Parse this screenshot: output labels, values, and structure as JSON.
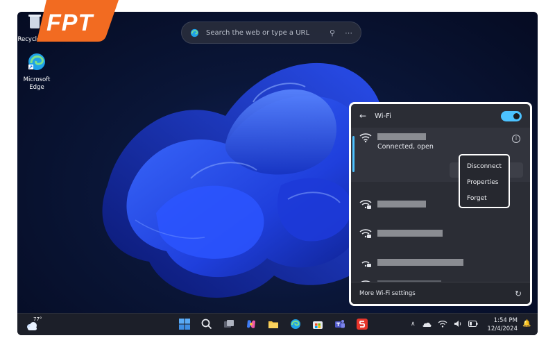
{
  "desktop": {
    "icons": [
      {
        "label": "Recycle Bin"
      },
      {
        "label": "Microsoft Edge"
      }
    ]
  },
  "logo": {
    "text": "FPT"
  },
  "search": {
    "placeholder": "Search the web or type a URL"
  },
  "wifi_panel": {
    "title": "Wi-Fi",
    "toggle_on": true,
    "connected_network": {
      "status": "Connected, open"
    },
    "context_menu": [
      "Disconnect",
      "Properties",
      "Forget"
    ],
    "footer_link": "More Wi-Fi settings"
  },
  "taskbar": {
    "weather_temp": "77°",
    "clock_time": "1:54 PM",
    "clock_date": "12/4/2024"
  },
  "colors": {
    "accent": "#4cc2ff",
    "fpt_orange": "#f26b21",
    "taskbar": "#1c1f29",
    "panel": "#2b2d35"
  }
}
